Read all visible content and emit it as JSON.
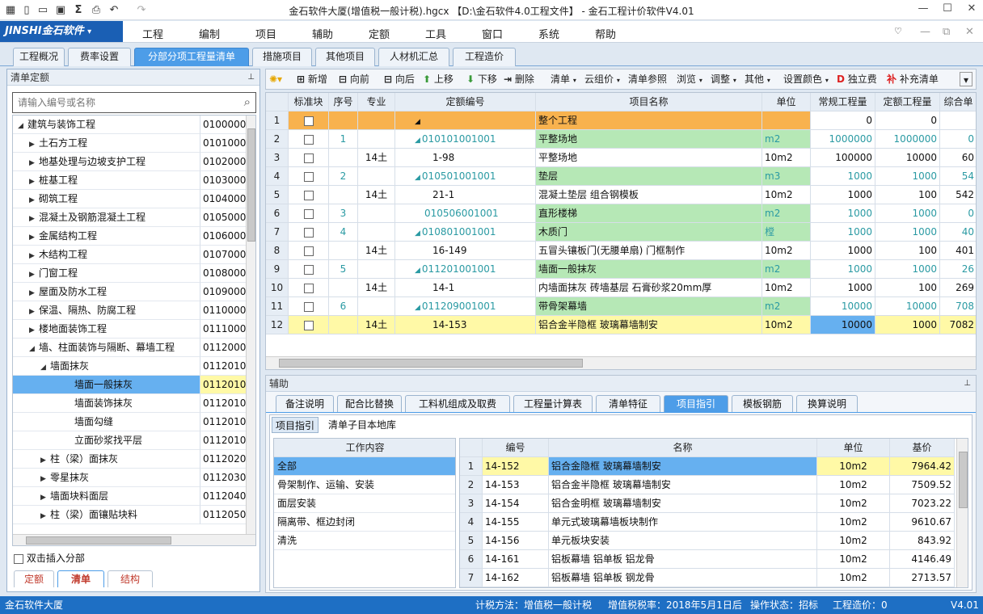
{
  "title": "金石软件大厦(增值税一般计税).hgcx 【D:\\金石软件4.0工程文件】 - 金石工程计价软件V4.01",
  "logo": "JINSHI金石软件",
  "menu": [
    "工程",
    "编制",
    "项目",
    "辅助",
    "定额",
    "工具",
    "窗口",
    "系统",
    "帮助"
  ],
  "tabs": [
    "工程概况",
    "费率设置",
    "分部分项工程量清单",
    "措施项目",
    "其他项目",
    "人材机汇总",
    "工程造价"
  ],
  "left_panel": {
    "header": "清单定额",
    "search_placeholder": "请输入编号或名称",
    "tree": [
      {
        "name": "建筑与装饰工程",
        "code": "0100000",
        "depth": 0,
        "arrow": "down"
      },
      {
        "name": "土石方工程",
        "code": "0101000",
        "depth": 1,
        "arrow": "right"
      },
      {
        "name": "地基处理与边坡支护工程",
        "code": "0102000",
        "depth": 1,
        "arrow": "right"
      },
      {
        "name": "桩基工程",
        "code": "0103000",
        "depth": 1,
        "arrow": "right"
      },
      {
        "name": "砌筑工程",
        "code": "0104000",
        "depth": 1,
        "arrow": "right"
      },
      {
        "name": "混凝土及钢筋混凝土工程",
        "code": "0105000",
        "depth": 1,
        "arrow": "right"
      },
      {
        "name": "金属结构工程",
        "code": "0106000",
        "depth": 1,
        "arrow": "right"
      },
      {
        "name": "木结构工程",
        "code": "0107000",
        "depth": 1,
        "arrow": "right"
      },
      {
        "name": "门窗工程",
        "code": "0108000",
        "depth": 1,
        "arrow": "right"
      },
      {
        "name": "屋面及防水工程",
        "code": "0109000",
        "depth": 1,
        "arrow": "right"
      },
      {
        "name": "保温、隔热、防腐工程",
        "code": "0110000",
        "depth": 1,
        "arrow": "right"
      },
      {
        "name": "楼地面装饰工程",
        "code": "0111000",
        "depth": 1,
        "arrow": "right"
      },
      {
        "name": "墙、柱面装饰与隔断、幕墙工程",
        "code": "0112000",
        "depth": 1,
        "arrow": "down"
      },
      {
        "name": "墙面抹灰",
        "code": "0112010",
        "depth": 2,
        "arrow": "down"
      },
      {
        "name": "墙面一般抹灰",
        "code": "0112010",
        "depth": 3,
        "arrow": "",
        "selected": true
      },
      {
        "name": "墙面装饰抹灰",
        "code": "0112010",
        "depth": 3,
        "arrow": ""
      },
      {
        "name": "墙面勾缝",
        "code": "0112010",
        "depth": 3,
        "arrow": ""
      },
      {
        "name": "立面砂浆找平层",
        "code": "0112010",
        "depth": 3,
        "arrow": ""
      },
      {
        "name": "柱（梁）面抹灰",
        "code": "0112020",
        "depth": 2,
        "arrow": "right"
      },
      {
        "name": "零星抹灰",
        "code": "0112030",
        "depth": 2,
        "arrow": "right"
      },
      {
        "name": "墙面块料面层",
        "code": "0112040",
        "depth": 2,
        "arrow": "right"
      },
      {
        "name": "柱（梁）面镶贴块料",
        "code": "0112050",
        "depth": 2,
        "arrow": "right"
      }
    ],
    "checkbox_label": "双击插入分部",
    "bottom_tabs": [
      "定额",
      "清单",
      "结构"
    ]
  },
  "toolbar": [
    "新增",
    "向前",
    "向后",
    "上移",
    "下移",
    "删除",
    "清单",
    "云组价",
    "清单参照",
    "浏览",
    "调整",
    "其他",
    "设置颜色",
    "独立费",
    "补充清单"
  ],
  "grid": {
    "headers": [
      "",
      "标准块",
      "序号",
      "专业",
      "定额编号",
      "项目名称",
      "单位",
      "常规工程量",
      "定额工程量",
      "综合单"
    ],
    "rows": [
      {
        "n": "1",
        "seq": "",
        "spec": "",
        "code": "",
        "name": "整个工程",
        "unit": "",
        "q1": "0",
        "q2": "0",
        "price": "",
        "style": "orange",
        "arrow": true
      },
      {
        "n": "2",
        "seq": "1",
        "spec": "",
        "code": "010101001001",
        "name": "平整场地",
        "unit": "m2",
        "q1": "1000000",
        "q2": "1000000",
        "price": "0",
        "style": "green",
        "arrow": true
      },
      {
        "n": "3",
        "seq": "",
        "spec": "14土",
        "code": "1-98",
        "name": "平整场地",
        "unit": "10m2",
        "q1": "100000",
        "q2": "10000",
        "price": "60",
        "style": ""
      },
      {
        "n": "4",
        "seq": "2",
        "spec": "",
        "code": "010501001001",
        "name": "垫层",
        "unit": "m3",
        "q1": "1000",
        "q2": "1000",
        "price": "54",
        "style": "green",
        "arrow": true
      },
      {
        "n": "5",
        "seq": "",
        "spec": "14土",
        "code": "21-1",
        "name": "混凝土垫层 组合钢模板",
        "unit": "10m2",
        "q1": "1000",
        "q2": "100",
        "price": "542",
        "style": ""
      },
      {
        "n": "6",
        "seq": "3",
        "spec": "",
        "code": "010506001001",
        "name": "直形楼梯",
        "unit": "m2",
        "q1": "1000",
        "q2": "1000",
        "price": "0",
        "style": "green"
      },
      {
        "n": "7",
        "seq": "4",
        "spec": "",
        "code": "010801001001",
        "name": "木质门",
        "unit": "樘",
        "q1": "1000",
        "q2": "1000",
        "price": "40",
        "style": "green",
        "arrow": true
      },
      {
        "n": "8",
        "seq": "",
        "spec": "14土",
        "code": "16-149",
        "name": "五冒头镶板门(无腰单扇) 门框制作",
        "unit": "10m2",
        "q1": "1000",
        "q2": "100",
        "price": "401",
        "style": ""
      },
      {
        "n": "9",
        "seq": "5",
        "spec": "",
        "code": "011201001001",
        "name": "墙面一般抹灰",
        "unit": "m2",
        "q1": "1000",
        "q2": "1000",
        "price": "26",
        "style": "green",
        "arrow": true
      },
      {
        "n": "10",
        "seq": "",
        "spec": "14土",
        "code": "14-1",
        "name": "内墙面抹灰 砖墙基层 石膏砂浆20mm厚",
        "unit": "10m2",
        "q1": "1000",
        "q2": "100",
        "price": "269",
        "style": ""
      },
      {
        "n": "11",
        "seq": "6",
        "spec": "",
        "code": "011209001001",
        "name": "带骨架幕墙",
        "unit": "m2",
        "q1": "10000",
        "q2": "10000",
        "price": "708",
        "style": "green",
        "arrow": true
      },
      {
        "n": "12",
        "seq": "",
        "spec": "14土",
        "code": "14-153",
        "name": "铝合金半隐框 玻璃幕墙制安",
        "unit": "10m2",
        "q1": "10000",
        "q2": "1000",
        "price": "7082",
        "style": "yellow"
      }
    ]
  },
  "aux": {
    "header": "辅助",
    "tabs": [
      "备注说明",
      "配合比替换",
      "工料机组成及取费",
      "工程量计算表",
      "清单特征",
      "项目指引",
      "模板钢筋",
      "换算说明"
    ],
    "subtabs": [
      "项目指引",
      "清单子目本地库"
    ],
    "work_header": "工作内容",
    "work_items": [
      "全部",
      "骨架制作、运输、安装",
      "面层安装",
      "隔离带、框边封闭",
      "清洗"
    ],
    "table_headers": [
      "",
      "编号",
      "名称",
      "单位",
      "基价"
    ],
    "table_rows": [
      {
        "n": "1",
        "code": "14-152",
        "name": "铝合金隐框 玻璃幕墙制安",
        "unit": "10m2",
        "price": "7964.42"
      },
      {
        "n": "2",
        "code": "14-153",
        "name": "铝合金半隐框 玻璃幕墙制安",
        "unit": "10m2",
        "price": "7509.52"
      },
      {
        "n": "3",
        "code": "14-154",
        "name": "铝合金明框 玻璃幕墙制安",
        "unit": "10m2",
        "price": "7023.22"
      },
      {
        "n": "4",
        "code": "14-155",
        "name": "单元式玻璃幕墙板块制作",
        "unit": "10m2",
        "price": "9610.67"
      },
      {
        "n": "5",
        "code": "14-156",
        "name": "单元板块安装",
        "unit": "10m2",
        "price": "843.92"
      },
      {
        "n": "6",
        "code": "14-161",
        "name": "铝板幕墙 铝单板 铝龙骨",
        "unit": "10m2",
        "price": "4146.49"
      },
      {
        "n": "7",
        "code": "14-162",
        "name": "铝板幕墙 铝单板 钢龙骨",
        "unit": "10m2",
        "price": "2713.57"
      }
    ]
  },
  "status": {
    "left": "金石软件大厦",
    "method_label": "计税方法：",
    "method": "增值税一般计税",
    "rate_label": "增值税税率：",
    "rate": "2018年5月1日后",
    "op_label": "操作状态：",
    "op": "招标",
    "cost_label": "工程造价：",
    "cost": "0",
    "version": "V4.01"
  },
  "colors": {
    "accent": "#1a5fb4",
    "tab_active": "#4d9de8",
    "green_row": "#b6e8b6",
    "orange_row": "#f8b24e",
    "yellow_row": "#fff9a6",
    "teal_text": "#2a9aa3"
  }
}
